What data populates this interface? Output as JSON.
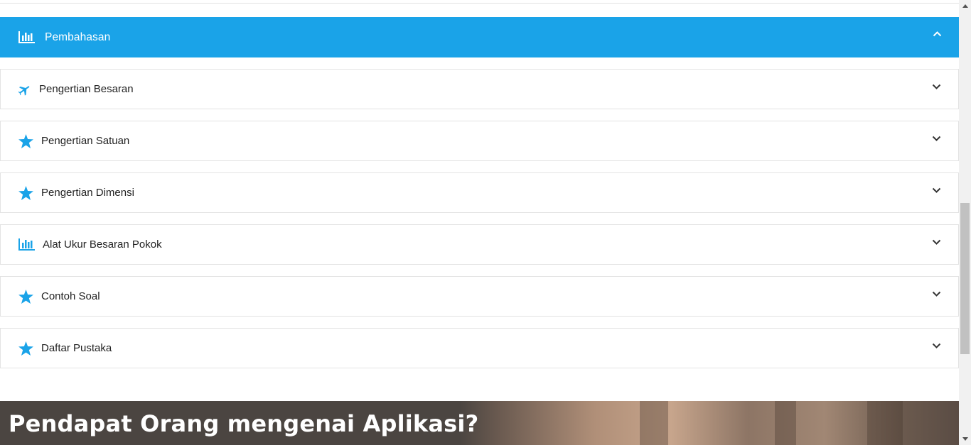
{
  "accordion": {
    "header": {
      "title": "Pembahasan",
      "icon": "bar-chart-icon"
    },
    "items": [
      {
        "label": "Pengertian Besaran",
        "icon": "plane-icon"
      },
      {
        "label": "Pengertian Satuan",
        "icon": "star-icon"
      },
      {
        "label": "Pengertian Dimensi",
        "icon": "star-icon"
      },
      {
        "label": "Alat Ukur Besaran Pokok",
        "icon": "bar-chart-icon"
      },
      {
        "label": "Contoh Soal",
        "icon": "star-icon"
      },
      {
        "label": "Daftar Pustaka",
        "icon": "star-icon"
      }
    ]
  },
  "testimonial": {
    "heading": "Pendapat Orang mengenai Aplikasi?"
  },
  "colors": {
    "accent": "#1aa3e8",
    "header_text": "#ffffff",
    "border": "#e3e3e3"
  }
}
